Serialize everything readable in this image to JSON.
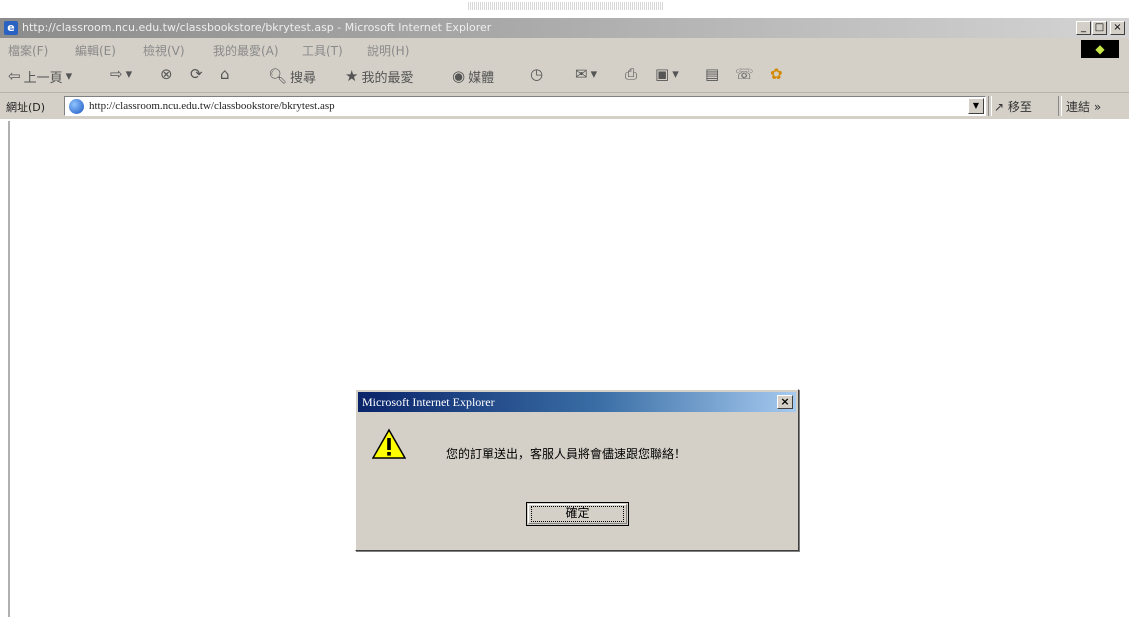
{
  "window": {
    "title": "http://classroom.ncu.edu.tw/classbookstore/bkrytest.asp - Microsoft Internet Explorer",
    "min": "_",
    "max": "□",
    "close": "×"
  },
  "menu": {
    "items": [
      "檔案(F)",
      "編輯(E)",
      "檢視(V)",
      "我的最愛(A)",
      "工具(T)",
      "說明(H)"
    ]
  },
  "toolbar": {
    "back": "上一頁",
    "search": "搜尋",
    "favorites": "我的最愛",
    "media": "媒體"
  },
  "address": {
    "label": "網址(D)",
    "url": "http://classroom.ncu.edu.tw/classbookstore/bkrytest.asp",
    "go": "移至",
    "links": "連結 »"
  },
  "dialog": {
    "title": "Microsoft Internet Explorer",
    "close": "×",
    "message": "您的訂單送出，客服人員將會儘速跟您聯絡！",
    "ok": "確定"
  }
}
